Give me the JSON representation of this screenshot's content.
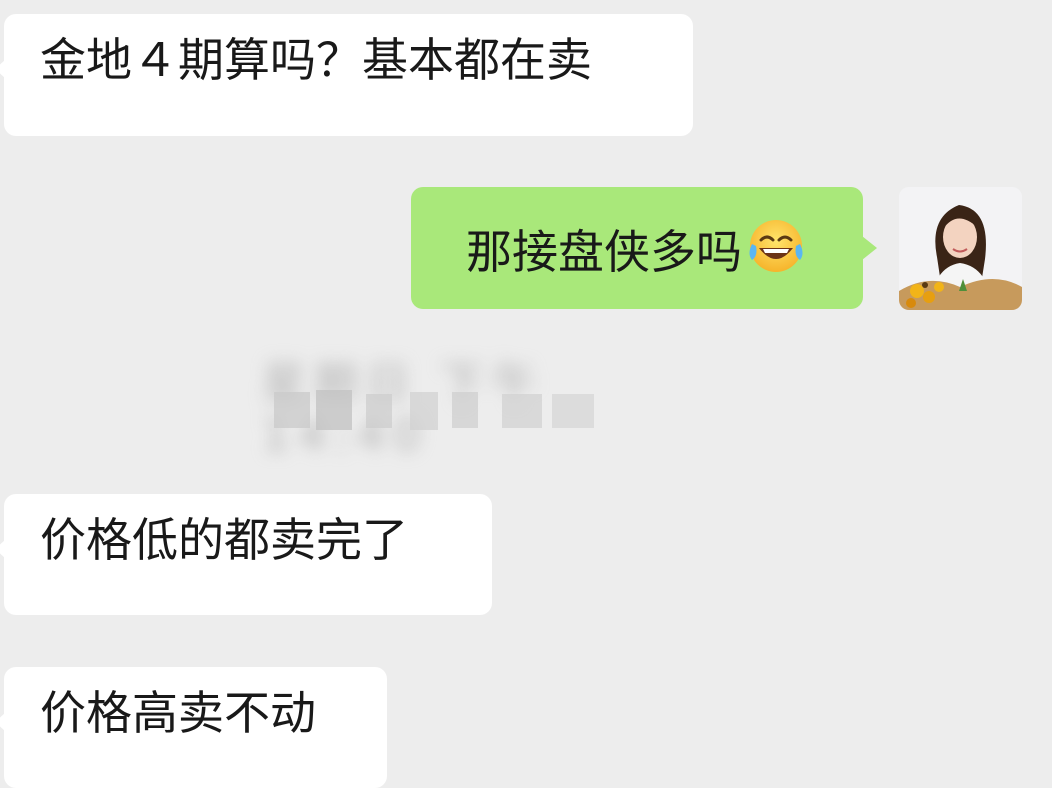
{
  "chat": {
    "messages": [
      {
        "direction": "incoming",
        "text": "金地４期算吗？基本都在卖"
      },
      {
        "direction": "outgoing",
        "text": "那接盘侠多吗",
        "emoji": "face-with-tears-of-joy-icon"
      },
      {
        "direction": "incoming",
        "text": "价格低的都卖完了"
      },
      {
        "direction": "incoming",
        "text": "价格高卖不动"
      }
    ],
    "timestamp": {
      "text": "星期日 下午14:40"
    }
  },
  "colors": {
    "background": "#ededed",
    "incoming_bubble": "#ffffff",
    "outgoing_bubble": "#a9e87a",
    "text": "#191919"
  }
}
